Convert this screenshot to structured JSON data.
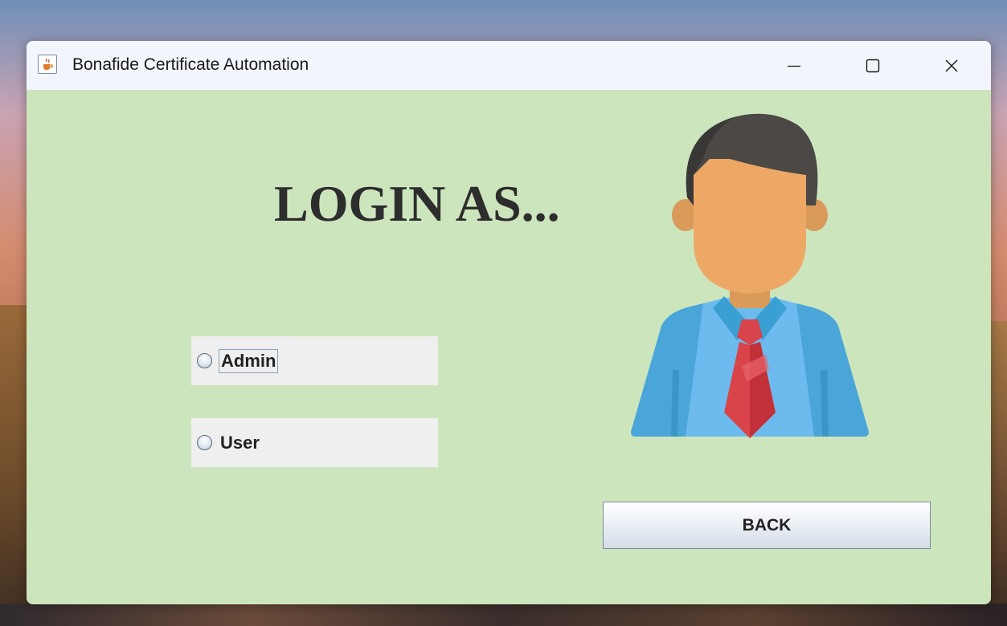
{
  "window": {
    "title": "Bonafide Certificate Automation",
    "app_icon": "java-cup-icon",
    "controls": [
      "minimize-icon",
      "maximize-icon",
      "close-icon"
    ]
  },
  "main": {
    "heading": "LOGIN AS...",
    "options": [
      {
        "label": "Admin",
        "selected": false,
        "focused": true
      },
      {
        "label": "User",
        "selected": false,
        "focused": false
      }
    ],
    "back_button": "BACK",
    "avatar_icon": "user-avatar-icon"
  },
  "colors": {
    "content_bg": "#cde5bd",
    "titlebar_bg": "#f2f5fb",
    "radio_row_bg": "#efefef"
  }
}
